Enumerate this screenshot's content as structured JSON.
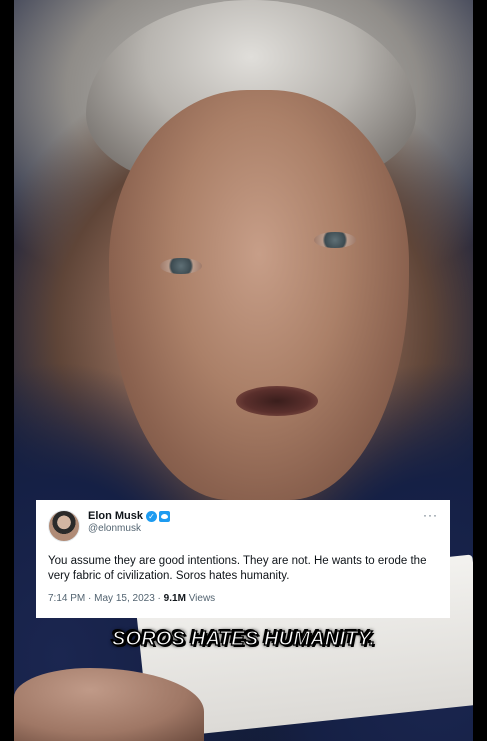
{
  "tweet": {
    "display_name": "Elon Musk",
    "handle": "@elonmusk",
    "verified_icon": "verified-badge-icon",
    "brand_icon": "twitter-bird-icon",
    "more_label": "···",
    "text": "You assume they are good intentions. They are not. He wants to erode the very fabric of civilization. Soros hates humanity.",
    "time": "7:14 PM",
    "separator": "·",
    "date": "May 15, 2023",
    "views_count": "9.1M",
    "views_label": "Views"
  },
  "caption": "SOROS HATES HUMANITY.",
  "colors": {
    "verified_blue": "#1d9bf0",
    "text_primary": "#0f1419",
    "text_secondary": "#536471",
    "background": "#000000"
  }
}
